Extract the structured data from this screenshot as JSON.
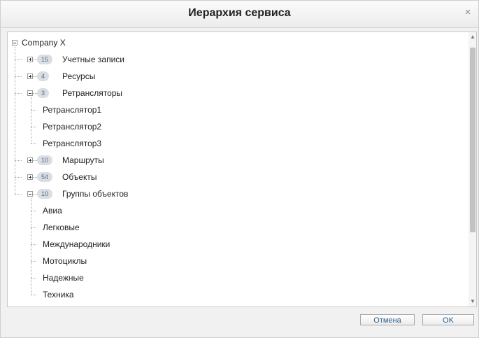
{
  "dialog": {
    "title": "Иерархия сервиса",
    "close_symbol": "×"
  },
  "tree": {
    "root": {
      "label": "Company X",
      "expanded": true
    },
    "nodes": [
      {
        "label": "Учетные записи",
        "count": "15",
        "expanded": false
      },
      {
        "label": "Ресурсы",
        "count": "4",
        "expanded": false
      },
      {
        "label": "Ретрансляторы",
        "count": "3",
        "expanded": true,
        "children": [
          "Ретранслятор1",
          "Ретранслятор2",
          "Ретранслятор3"
        ]
      },
      {
        "label": "Маршруты",
        "count": "10",
        "expanded": false
      },
      {
        "label": "Объекты",
        "count": "54",
        "expanded": false
      },
      {
        "label": "Группы объектов",
        "count": "10",
        "expanded": true,
        "children": [
          "Авиа",
          "Легковые",
          "Международники",
          "Мотоциклы",
          "Надежные",
          "Техника"
        ]
      }
    ]
  },
  "icons": {
    "collapse": "minus-box-icon",
    "expand": "plus-box-icon",
    "scroll_up": "▲",
    "scroll_down": "▼"
  },
  "buttons": {
    "cancel": "Отмена",
    "ok": "OK"
  }
}
